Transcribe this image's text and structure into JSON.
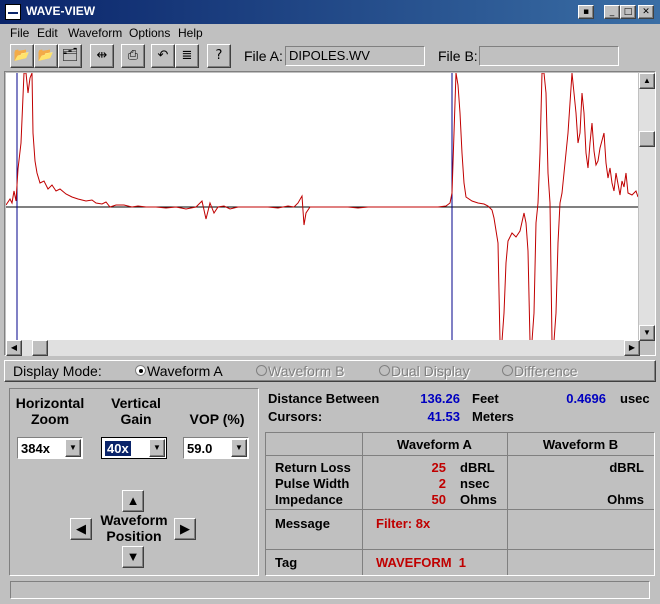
{
  "window": {
    "title": "WAVE-VIEW"
  },
  "menu": [
    "File",
    "Edit",
    "Waveform",
    "Options",
    "Help"
  ],
  "toolbar": {
    "file_a_label": "File A:",
    "file_a_value": "DIPOLES.WV",
    "file_b_label": "File B:",
    "file_b_value": "",
    "buttons": [
      "open-file-a-icon",
      "open-file-b-icon",
      "open-folder-icon",
      "cursors-icon",
      "print-icon",
      "undo-icon",
      "notes-icon",
      "help-icon"
    ]
  },
  "display_mode": {
    "label": "Display Mode:",
    "options": [
      {
        "label": "Waveform A",
        "selected": true,
        "enabled": true
      },
      {
        "label": "Waveform B",
        "selected": false,
        "enabled": false
      },
      {
        "label": "Dual Display",
        "selected": false,
        "enabled": false
      },
      {
        "label": "Difference",
        "selected": false,
        "enabled": false
      }
    ]
  },
  "controls": {
    "horizontal_zoom_label_1": "Horizontal",
    "horizontal_zoom_label_2": "Zoom",
    "horizontal_zoom_value": "384x",
    "vertical_gain_label_1": "Vertical",
    "vertical_gain_label_2": "Gain",
    "vertical_gain_value": "40x",
    "vop_label": "VOP (%)",
    "vop_value": "59.0",
    "position_label_1": "Waveform",
    "position_label_2": "Position"
  },
  "distance": {
    "label_1": "Distance Between",
    "label_2": "Cursors:",
    "feet_value": "136.26",
    "feet_unit": "Feet",
    "meters_value": "41.53",
    "meters_unit": "Meters",
    "time_value": "0.4696",
    "time_unit": "usec"
  },
  "table": {
    "col_a": "Waveform A",
    "col_b": "Waveform B",
    "rows": [
      {
        "label": "Return Loss",
        "a_value": "25",
        "a_unit": "dBRL",
        "b_unit": "dBRL"
      },
      {
        "label": "Pulse Width",
        "a_value": "2",
        "a_unit": "nsec",
        "b_unit": ""
      },
      {
        "label": "Impedance",
        "a_value": "50",
        "a_unit": "Ohms",
        "b_unit": "Ohms"
      }
    ],
    "message_label": "Message",
    "message_value": "Filter: 8x",
    "tag_label": "Tag",
    "tag_value": "WAVEFORM  1"
  },
  "colors": {
    "trace": "#c00000",
    "cursor": "#00008b",
    "baseline": "#000000",
    "value_blue": "#0000c0",
    "value_red": "#c00000"
  }
}
